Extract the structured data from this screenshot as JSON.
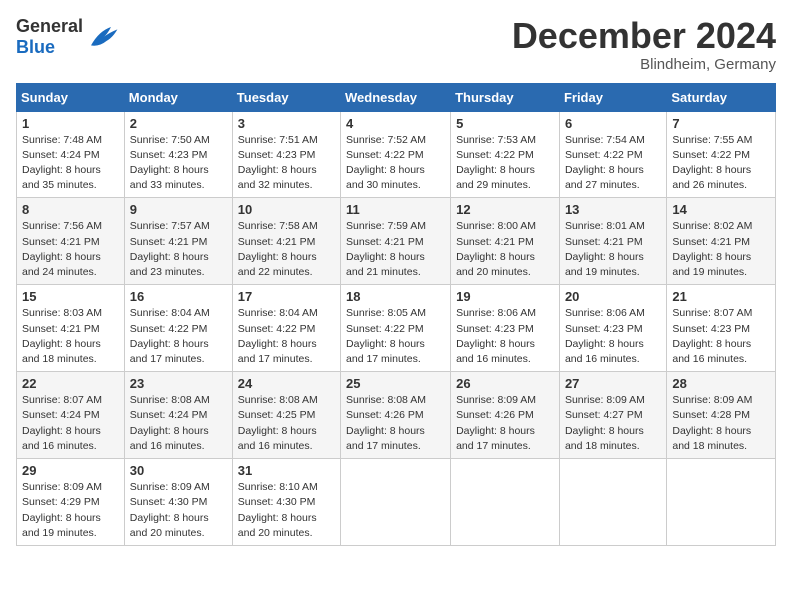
{
  "logo": {
    "general": "General",
    "blue": "Blue"
  },
  "header": {
    "month": "December 2024",
    "location": "Blindheim, Germany"
  },
  "weekdays": [
    "Sunday",
    "Monday",
    "Tuesday",
    "Wednesday",
    "Thursday",
    "Friday",
    "Saturday"
  ],
  "weeks": [
    [
      {
        "day": "1",
        "sunrise": "Sunrise: 7:48 AM",
        "sunset": "Sunset: 4:24 PM",
        "daylight": "Daylight: 8 hours and 35 minutes."
      },
      {
        "day": "2",
        "sunrise": "Sunrise: 7:50 AM",
        "sunset": "Sunset: 4:23 PM",
        "daylight": "Daylight: 8 hours and 33 minutes."
      },
      {
        "day": "3",
        "sunrise": "Sunrise: 7:51 AM",
        "sunset": "Sunset: 4:23 PM",
        "daylight": "Daylight: 8 hours and 32 minutes."
      },
      {
        "day": "4",
        "sunrise": "Sunrise: 7:52 AM",
        "sunset": "Sunset: 4:22 PM",
        "daylight": "Daylight: 8 hours and 30 minutes."
      },
      {
        "day": "5",
        "sunrise": "Sunrise: 7:53 AM",
        "sunset": "Sunset: 4:22 PM",
        "daylight": "Daylight: 8 hours and 29 minutes."
      },
      {
        "day": "6",
        "sunrise": "Sunrise: 7:54 AM",
        "sunset": "Sunset: 4:22 PM",
        "daylight": "Daylight: 8 hours and 27 minutes."
      },
      {
        "day": "7",
        "sunrise": "Sunrise: 7:55 AM",
        "sunset": "Sunset: 4:22 PM",
        "daylight": "Daylight: 8 hours and 26 minutes."
      }
    ],
    [
      {
        "day": "8",
        "sunrise": "Sunrise: 7:56 AM",
        "sunset": "Sunset: 4:21 PM",
        "daylight": "Daylight: 8 hours and 24 minutes."
      },
      {
        "day": "9",
        "sunrise": "Sunrise: 7:57 AM",
        "sunset": "Sunset: 4:21 PM",
        "daylight": "Daylight: 8 hours and 23 minutes."
      },
      {
        "day": "10",
        "sunrise": "Sunrise: 7:58 AM",
        "sunset": "Sunset: 4:21 PM",
        "daylight": "Daylight: 8 hours and 22 minutes."
      },
      {
        "day": "11",
        "sunrise": "Sunrise: 7:59 AM",
        "sunset": "Sunset: 4:21 PM",
        "daylight": "Daylight: 8 hours and 21 minutes."
      },
      {
        "day": "12",
        "sunrise": "Sunrise: 8:00 AM",
        "sunset": "Sunset: 4:21 PM",
        "daylight": "Daylight: 8 hours and 20 minutes."
      },
      {
        "day": "13",
        "sunrise": "Sunrise: 8:01 AM",
        "sunset": "Sunset: 4:21 PM",
        "daylight": "Daylight: 8 hours and 19 minutes."
      },
      {
        "day": "14",
        "sunrise": "Sunrise: 8:02 AM",
        "sunset": "Sunset: 4:21 PM",
        "daylight": "Daylight: 8 hours and 19 minutes."
      }
    ],
    [
      {
        "day": "15",
        "sunrise": "Sunrise: 8:03 AM",
        "sunset": "Sunset: 4:21 PM",
        "daylight": "Daylight: 8 hours and 18 minutes."
      },
      {
        "day": "16",
        "sunrise": "Sunrise: 8:04 AM",
        "sunset": "Sunset: 4:22 PM",
        "daylight": "Daylight: 8 hours and 17 minutes."
      },
      {
        "day": "17",
        "sunrise": "Sunrise: 8:04 AM",
        "sunset": "Sunset: 4:22 PM",
        "daylight": "Daylight: 8 hours and 17 minutes."
      },
      {
        "day": "18",
        "sunrise": "Sunrise: 8:05 AM",
        "sunset": "Sunset: 4:22 PM",
        "daylight": "Daylight: 8 hours and 17 minutes."
      },
      {
        "day": "19",
        "sunrise": "Sunrise: 8:06 AM",
        "sunset": "Sunset: 4:23 PM",
        "daylight": "Daylight: 8 hours and 16 minutes."
      },
      {
        "day": "20",
        "sunrise": "Sunrise: 8:06 AM",
        "sunset": "Sunset: 4:23 PM",
        "daylight": "Daylight: 8 hours and 16 minutes."
      },
      {
        "day": "21",
        "sunrise": "Sunrise: 8:07 AM",
        "sunset": "Sunset: 4:23 PM",
        "daylight": "Daylight: 8 hours and 16 minutes."
      }
    ],
    [
      {
        "day": "22",
        "sunrise": "Sunrise: 8:07 AM",
        "sunset": "Sunset: 4:24 PM",
        "daylight": "Daylight: 8 hours and 16 minutes."
      },
      {
        "day": "23",
        "sunrise": "Sunrise: 8:08 AM",
        "sunset": "Sunset: 4:24 PM",
        "daylight": "Daylight: 8 hours and 16 minutes."
      },
      {
        "day": "24",
        "sunrise": "Sunrise: 8:08 AM",
        "sunset": "Sunset: 4:25 PM",
        "daylight": "Daylight: 8 hours and 16 minutes."
      },
      {
        "day": "25",
        "sunrise": "Sunrise: 8:08 AM",
        "sunset": "Sunset: 4:26 PM",
        "daylight": "Daylight: 8 hours and 17 minutes."
      },
      {
        "day": "26",
        "sunrise": "Sunrise: 8:09 AM",
        "sunset": "Sunset: 4:26 PM",
        "daylight": "Daylight: 8 hours and 17 minutes."
      },
      {
        "day": "27",
        "sunrise": "Sunrise: 8:09 AM",
        "sunset": "Sunset: 4:27 PM",
        "daylight": "Daylight: 8 hours and 18 minutes."
      },
      {
        "day": "28",
        "sunrise": "Sunrise: 8:09 AM",
        "sunset": "Sunset: 4:28 PM",
        "daylight": "Daylight: 8 hours and 18 minutes."
      }
    ],
    [
      {
        "day": "29",
        "sunrise": "Sunrise: 8:09 AM",
        "sunset": "Sunset: 4:29 PM",
        "daylight": "Daylight: 8 hours and 19 minutes."
      },
      {
        "day": "30",
        "sunrise": "Sunrise: 8:09 AM",
        "sunset": "Sunset: 4:30 PM",
        "daylight": "Daylight: 8 hours and 20 minutes."
      },
      {
        "day": "31",
        "sunrise": "Sunrise: 8:10 AM",
        "sunset": "Sunset: 4:30 PM",
        "daylight": "Daylight: 8 hours and 20 minutes."
      },
      null,
      null,
      null,
      null
    ]
  ]
}
